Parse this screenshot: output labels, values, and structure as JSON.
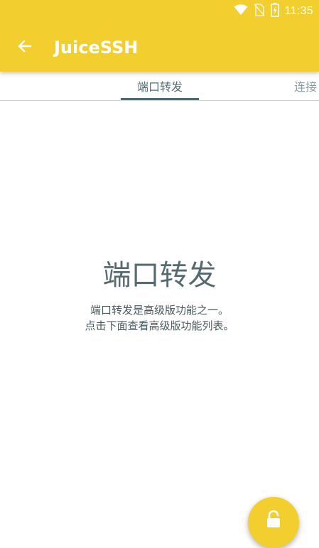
{
  "status_bar": {
    "time": "11:35",
    "icons": [
      "wifi-icon",
      "no-sim-icon",
      "battery-charging-icon"
    ]
  },
  "app_bar": {
    "title": "JuiceSSH",
    "back_icon": "arrow-left-icon"
  },
  "tabs": [
    {
      "label": "端口转发",
      "selected": true
    },
    {
      "label": "连接",
      "selected": false
    }
  ],
  "empty_state": {
    "title": "端口转发",
    "line1": "端口转发是高级版功能之一。",
    "line2": "点击下面查看高级版功能列表。"
  },
  "fab": {
    "icon": "unlock-icon"
  },
  "colors": {
    "accent": "#f2cf2f",
    "tab_indicator": "#4e6a6f",
    "text_primary": "#566b70"
  }
}
